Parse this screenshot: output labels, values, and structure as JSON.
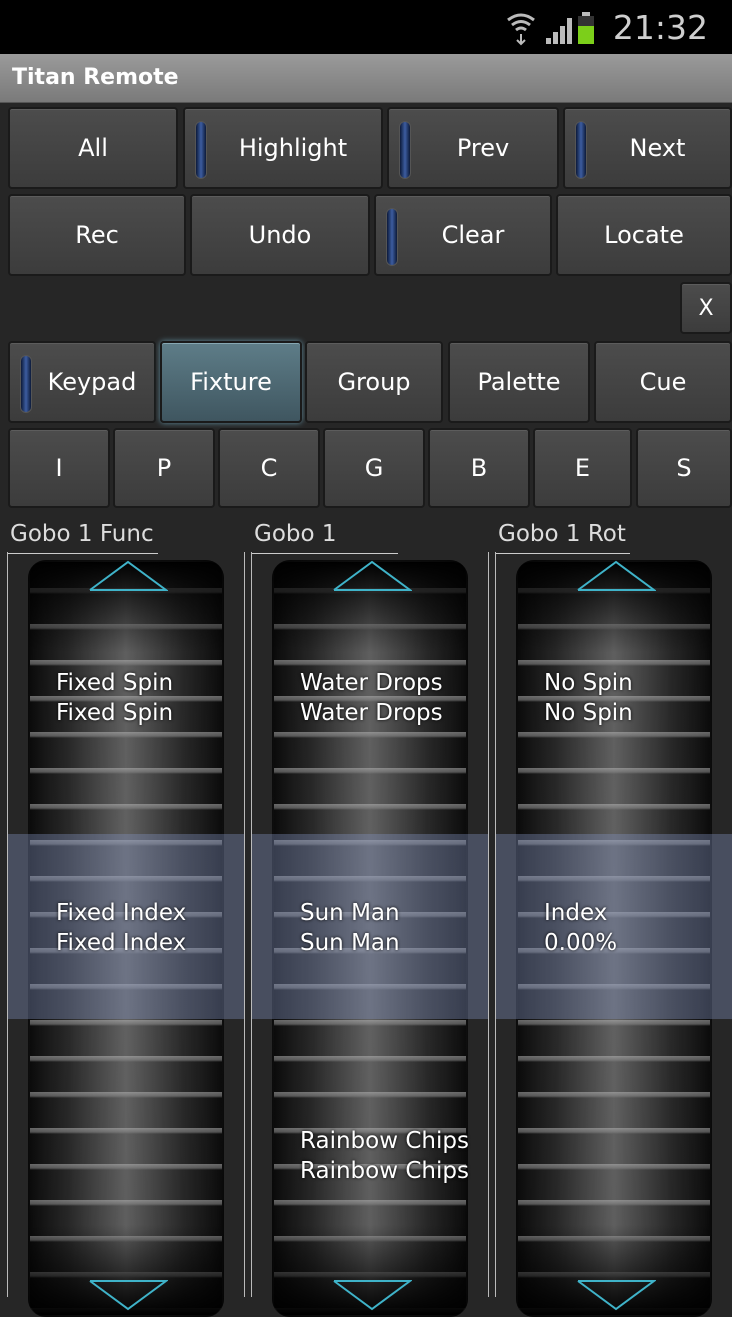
{
  "status": {
    "time": "21:32",
    "icons": [
      "wifi-icon",
      "signal-icon",
      "battery-icon"
    ],
    "battery_color": "#7ccf1a"
  },
  "app": {
    "title": "Titan Remote"
  },
  "row1": [
    "All",
    "Highlight",
    "Prev",
    "Next"
  ],
  "row2": [
    "Rec",
    "Undo",
    "Clear",
    "Locate"
  ],
  "close_label": "X",
  "modes": [
    "Keypad",
    "Fixture",
    "Group",
    "Palette",
    "Cue"
  ],
  "active_mode": "Fixture",
  "attributes": [
    "I",
    "P",
    "C",
    "G",
    "B",
    "E",
    "S"
  ],
  "faders": [
    {
      "label": "Gobo 1 Func",
      "top": [
        "Fixed Spin",
        "Fixed Spin"
      ],
      "current": [
        "Fixed Index",
        "Fixed Index"
      ],
      "bottom": [
        "",
        ""
      ]
    },
    {
      "label": "Gobo 1",
      "top": [
        "Water Drops",
        "Water Drops"
      ],
      "current": [
        "Sun Man",
        "Sun Man"
      ],
      "bottom": [
        "Rainbow Chips",
        "Rainbow Chips"
      ]
    },
    {
      "label": "Gobo 1 Rot",
      "top": [
        "No Spin",
        "No Spin"
      ],
      "current": [
        "Index",
        "0.00%"
      ],
      "bottom": [
        "",
        ""
      ]
    }
  ],
  "colors": {
    "accent": "#5f8a9a",
    "arrow": "#3fb3c9",
    "indicator": "#3d5da0"
  }
}
